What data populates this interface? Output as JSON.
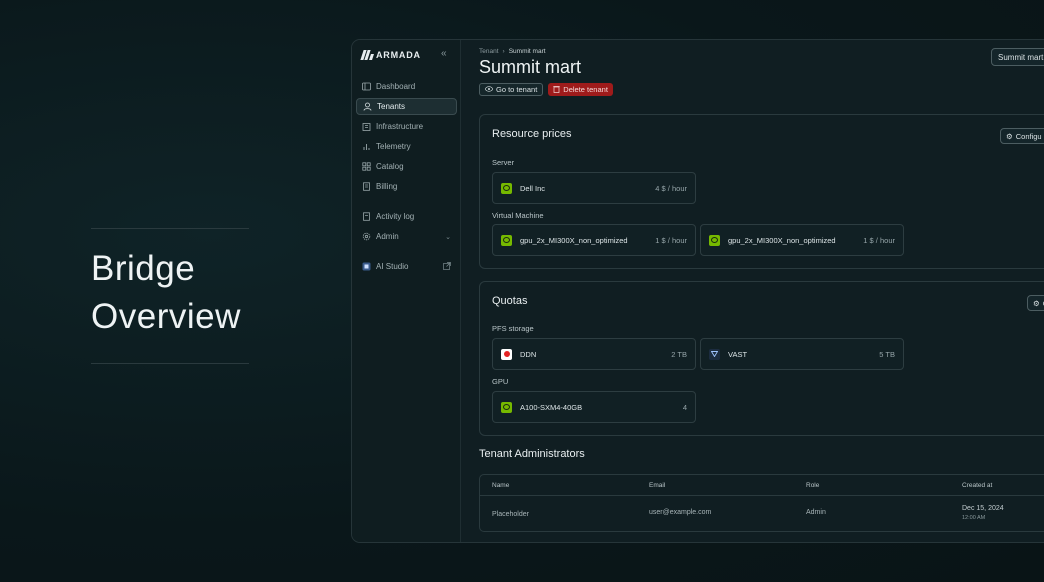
{
  "hero": {
    "title_line1": "Bridge",
    "title_line2": "Overview"
  },
  "app": {
    "logo": "ARMADA",
    "collapse_icon": "chevrons-left-icon"
  },
  "sidebar": {
    "items": [
      {
        "label": "Dashboard",
        "icon": "dashboard-icon"
      },
      {
        "label": "Tenants",
        "icon": "users-icon",
        "active": true
      },
      {
        "label": "Infrastructure",
        "icon": "building-icon"
      },
      {
        "label": "Telemetry",
        "icon": "bar-chart-icon"
      },
      {
        "label": "Catalog",
        "icon": "catalog-icon"
      },
      {
        "label": "Billing",
        "icon": "receipt-icon"
      },
      {
        "label": "Activity log",
        "icon": "log-icon"
      },
      {
        "label": "Admin",
        "icon": "gear-icon"
      },
      {
        "label": "AI Studio",
        "icon": "ai-studio-icon"
      }
    ]
  },
  "header": {
    "breadcrumb": [
      "Tenant",
      "Summit mart"
    ],
    "title": "Summit mart",
    "go_to_tenant": "Go to tenant",
    "delete_tenant": "Delete tenant",
    "tenant_select": "Summit mart"
  },
  "resource_prices": {
    "title": "Resource prices",
    "configure": "Configu",
    "server_label": "Server",
    "server": [
      {
        "name": "Dell Inc",
        "value": "4 $ / hour"
      }
    ],
    "vm_label": "Virtual Machine",
    "vm": [
      {
        "name": "gpu_2x_MI300X_non_optimized",
        "value": "1 $ / hour"
      },
      {
        "name": "gpu_2x_MI300X_non_optimized",
        "value": "1 $ / hour"
      }
    ]
  },
  "quotas": {
    "title": "Quotas",
    "configure": "C",
    "pfs_label": "PFS storage",
    "pfs": [
      {
        "name": "DDN",
        "value": "2 TB"
      },
      {
        "name": "VAST",
        "value": "5 TB"
      }
    ],
    "gpu_label": "GPU",
    "gpu": [
      {
        "name": "A100-SXM4-40GB",
        "value": "4"
      }
    ]
  },
  "admins": {
    "title": "Tenant Administrators",
    "columns": [
      "Name",
      "Email",
      "Role",
      "Created at"
    ],
    "rows": [
      {
        "name": "Placeholder",
        "email": "user@example.com",
        "role": "Admin",
        "date": "Dec 15, 2024",
        "time": "12:00 AM"
      }
    ]
  },
  "colors": {
    "background": "#0b1a1d",
    "accent_danger": "#9f1b1b",
    "nvidia_green": "#76b900"
  }
}
